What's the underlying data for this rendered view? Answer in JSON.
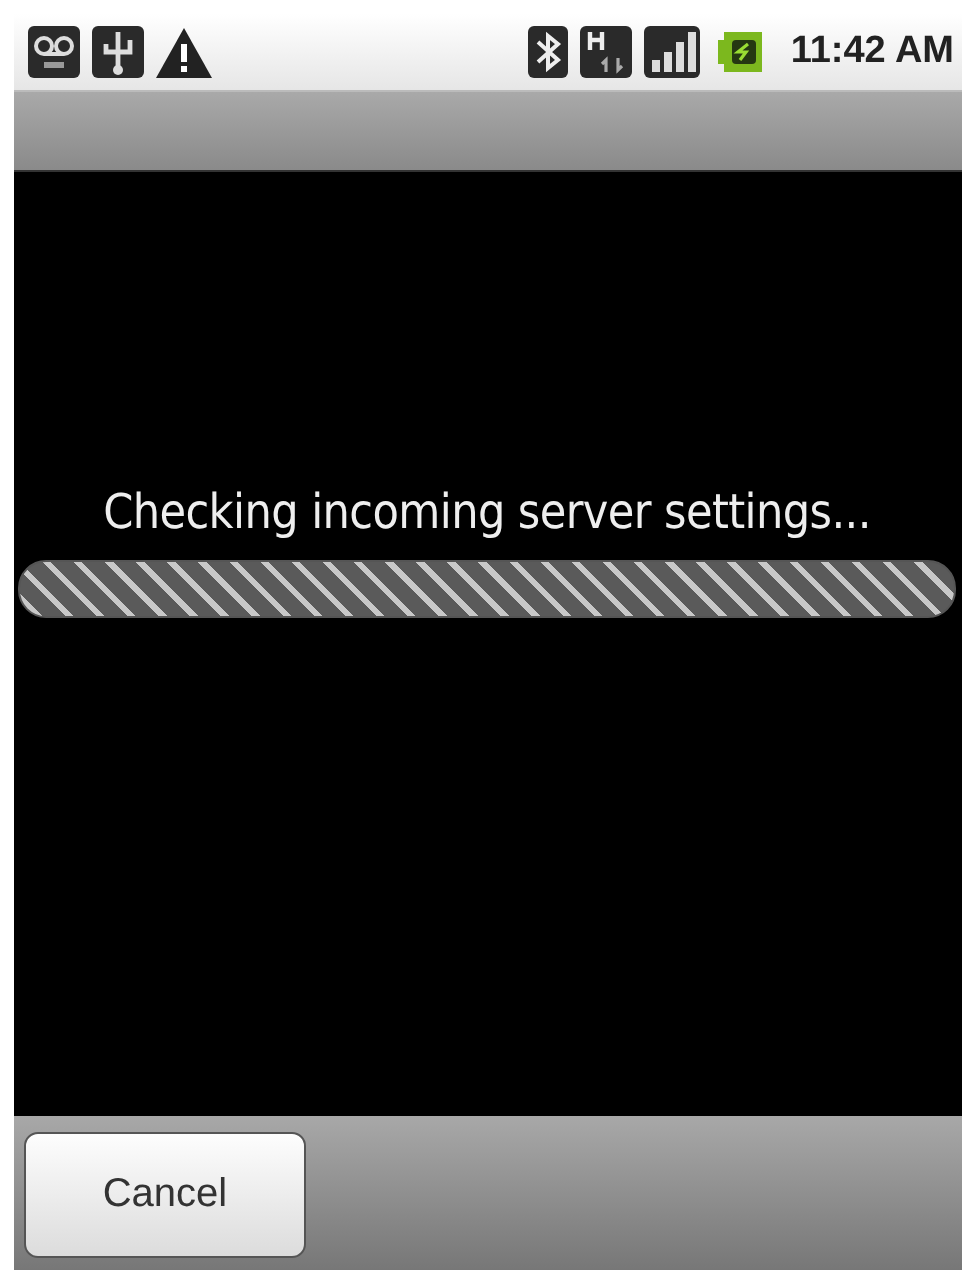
{
  "status_bar": {
    "time": "11:42 AM"
  },
  "dialog": {
    "message": "Checking incoming server settings...",
    "progress": {
      "indeterminate": true
    }
  },
  "buttons": [
    {
      "label": "Cancel"
    }
  ]
}
